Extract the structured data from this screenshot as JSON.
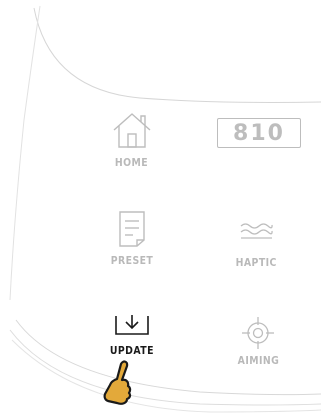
{
  "menu": {
    "items": [
      {
        "label": "HOME",
        "icon": "home-icon",
        "active": false
      },
      {
        "value": "810",
        "icon": "level-display"
      },
      {
        "label": "PRESET",
        "icon": "document-icon",
        "active": false
      },
      {
        "label": "HAPTIC",
        "icon": "haptic-waves-icon",
        "active": false
      },
      {
        "label": "UPDATE",
        "icon": "download-icon",
        "active": true
      },
      {
        "label": "AIMING",
        "icon": "crosshair-icon",
        "active": false
      }
    ]
  },
  "colors": {
    "inactive": "#b9b9b9",
    "active": "#1a1a1a",
    "pointer_fill": "#e3a93a",
    "outline": "#bdbdbd"
  }
}
